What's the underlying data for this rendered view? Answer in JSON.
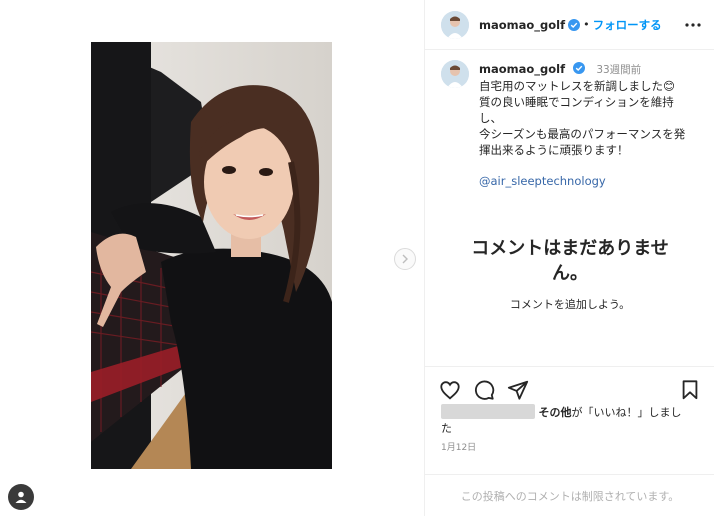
{
  "post": {
    "username": "maomao_golf",
    "dot": "•",
    "follow_label": "フォローする",
    "time_ago": "33週間前",
    "caption_lines": [
      "自宅用のマットレスを新調しました😊",
      "質の良い睡眠でコンディションを維持",
      "し、",
      "今シーズンも最高のパフォーマンスを発",
      "揮出来るように頑張ります！"
    ],
    "mention": "@air_sleeptechnology",
    "no_comments_title_1": "コメントはまだありませ",
    "no_comments_title_2": "ん。",
    "no_comments_sub": "コメントを追加しよう。",
    "likes_others": "その他",
    "likes_suffix_1": "が「いいね！」しまし",
    "likes_suffix_2": "た",
    "date": "1月12日",
    "comments_disabled": "この投稿へのコメントは制限されています。"
  },
  "icons": {
    "verified": "verified-badge-icon",
    "more": "more-horizontal-icon",
    "next": "chevron-right-icon",
    "like": "heart-icon",
    "comment": "comment-bubble-icon",
    "share": "paper-plane-icon",
    "save": "bookmark-icon",
    "profile": "user-silhouette-icon"
  },
  "colors": {
    "accent": "#0095f6",
    "verified": "#3897f0",
    "mention": "#3767a8",
    "muted": "#8e8e8e"
  }
}
